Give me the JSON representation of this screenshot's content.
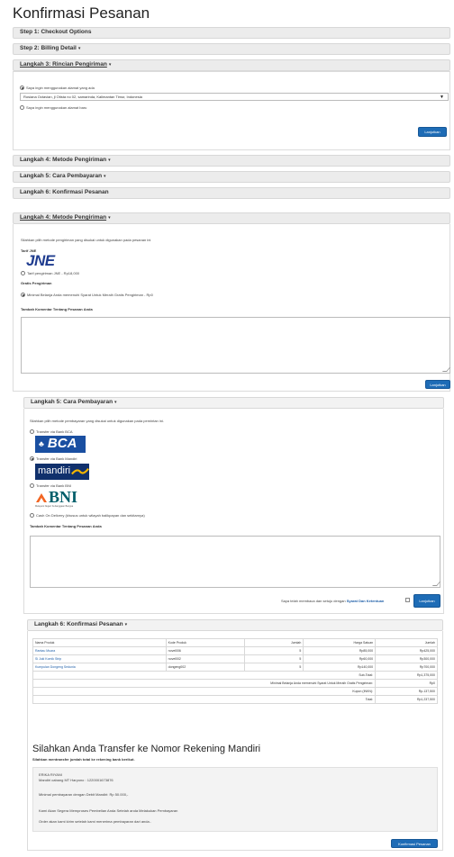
{
  "page_title": "Konfirmasi Pesanan",
  "steps": {
    "step1": "Step 1: Checkout Options",
    "step2": "Step 2: Billing Detail",
    "step3": "Langkah 3: Rincian Pengiriman",
    "step4": "Langkah 4: Metode Pengiriman",
    "step5": "Langkah 5: Cara Pembayaran",
    "step6": "Langkah 6: Konfirmasi Pesanan",
    "caret": "▾"
  },
  "shipping_address": {
    "option_existing": "Saya ingin menggunakan alamat yang ada",
    "selected_address": "Rosiana Octavian, jl Otista no 02, samarinda, Kalimantan Timur, Indonesia",
    "option_new": "Saya ingin menggunakan alamat baru",
    "continue_label": "Lanjutkan"
  },
  "shipping_method": {
    "intro": "Silahkan pilih metode pengiriman yang disukai untuk digunakan pada pesanan ini",
    "jne_heading": "Tarif JNE",
    "jne_logo": "JNE",
    "jne_option": "Tarif pengiriman JNE - Rp18,000",
    "free_heading": "Gratis Pengiriman",
    "free_option": "Minimal Belanja Anda memenuhi Syarat Untuk Meraih Gratis Pengiriman - Rp0",
    "comment_label": "Tambah Komentar Tentang Pesanan Anda",
    "continue_label": "Lanjutkan"
  },
  "payment_method": {
    "intro": "Silahkan pilih metode pembayaran yang disukai untuk digunakan pada pemintan ini.",
    "options": [
      {
        "label": "Transfer via Bank BCA",
        "logo": "BCA"
      },
      {
        "label": "Transfer via Bank Mandiri",
        "logo": "mandiri"
      },
      {
        "label": "Transfer via Bank BNI",
        "logo": "BNI"
      },
      {
        "label": "Cash On Delivery (khusus untuk wilayah balikpapan dan sekitarnya)",
        "logo": ""
      }
    ],
    "selected_index": 1,
    "bni_tagline": "Melayani Negeri Kebanggaan Bangsa",
    "comment_label": "Tambah Komentar Tentang Pesanan Anda",
    "terms_prefix": "Saya telah membaca dan setuju dengan",
    "terms_link": "Syarat Dan Ketentuan",
    "continue_label": "Lanjutkan"
  },
  "order_confirm": {
    "headers": [
      "Nama Produk",
      "Kode Produk",
      "Jumlah",
      "Harga Satuan",
      "Jumlah"
    ],
    "rows": [
      [
        "Rantau Muara",
        "novel006",
        "5",
        "Rp85,000",
        "Rp425,000"
      ],
      [
        "Si Juki Komik Strip",
        "novel002",
        "5",
        "Rp60,000",
        "Rp300,000"
      ],
      [
        "Kumpulan Dongeng Sedunia",
        "dongeng002",
        "5",
        "Rp140,000",
        "Rp700,000"
      ]
    ],
    "totals": [
      {
        "label": "Sub-Total:",
        "value": "Rp1,375,000"
      },
      {
        "label": "Minimal Belanja Anda memenuhi Syarat Untuk Meraih Gratis Pengiriman:",
        "value": "Rp0"
      },
      {
        "label": "Kupon (INKN):",
        "value": "Rp-137,500"
      },
      {
        "label": "Total:",
        "value": "Rp1,237,500"
      }
    ],
    "transfer_heading": "Silahkan Anda Transfer ke Nomor Rekening Mandiri",
    "transfer_sub": "Silahkan mentransfer jumlah total ke rekening bank berikut.",
    "account_name": "ERIKA RIYANI",
    "account_line": "Mandiri cabang MT Haryono : 1220001673876",
    "min_payment": "Minimal pembayaran dengan Debit Mandiri: Rp 50.000,-",
    "note1": "Kami Akan Segera Memproses Pembelian Anda Setelah anda Melakukan Pembayaran",
    "note2": "Order akan kami kirim setelah kami menerima pembayaran dari anda..",
    "confirm_label": "Konfirmasi Pesanan"
  }
}
